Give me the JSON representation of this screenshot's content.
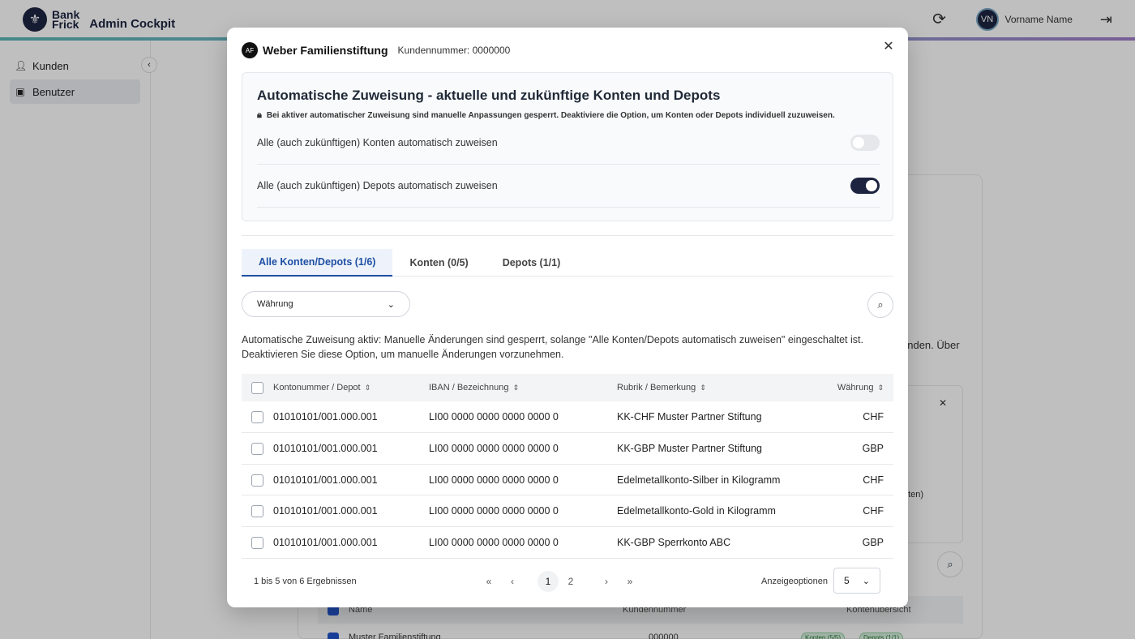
{
  "app": {
    "brand_line1": "Bank",
    "brand_line2": "Frick",
    "title": "Admin Cockpit",
    "user_initials": "VN",
    "user_name": "Vorname Name"
  },
  "sidebar": {
    "items": [
      {
        "label": "Kunden",
        "icon": "user-icon"
      },
      {
        "label": "Benutzer",
        "icon": "user-card-icon"
      }
    ]
  },
  "background": {
    "text_fragment": "unden. Über",
    "small_fragment": "nten)",
    "table_headers": [
      "Name",
      "Kundennummer",
      "Kontenübersicht"
    ],
    "row": {
      "name": "Muster Familienstiftung",
      "number": "000000",
      "badge1": "Konten (5/5)",
      "badge2": "Depots (1/1)"
    }
  },
  "modal": {
    "badge": "AF",
    "client_name": "Weber Familienstiftung",
    "client_number": "Kundennummer: 0000000",
    "auto": {
      "title": "Automatische Zuweisung - aktuelle und zukünftige Konten und Depots",
      "note": "Bei aktiver automatischer Zuweisung sind manuelle Anpassungen gesperrt. Deaktiviere die Option, um Konten oder Depots individuell zuzuweisen.",
      "toggles": [
        {
          "label": "Alle (auch zukünftigen) Konten automatisch zuweisen",
          "on": false
        },
        {
          "label": "Alle (auch zukünftigen) Depots automatisch zuweisen",
          "on": true
        }
      ]
    },
    "tabs": [
      {
        "label": "Alle Konten/Depots (1/6)",
        "active": true
      },
      {
        "label": "Konten (0/5)",
        "active": false
      },
      {
        "label": "Depots (1/1)",
        "active": false
      }
    ],
    "filter_label": "Währung",
    "info_line1": "Automatische Zuweisung aktiv: Manuelle Änderungen sind gesperrt, solange \"Alle Konten/Depots automatisch zuweisen\" eingeschaltet ist.",
    "info_line2": "Deaktivieren Sie diese Option, um manuelle Änderungen vorzunehmen.",
    "table": {
      "headers": {
        "konto": "Kontonummer / Depot",
        "iban": "IBAN / Bezeichnung",
        "rubrik": "Rubrik / Bemerkung",
        "currency": "Währung"
      },
      "rows": [
        {
          "konto": "01010101/001.000.001",
          "iban": "LI00 0000 0000 0000 0000 0",
          "rubrik": "KK-CHF Muster Partner Stiftung",
          "currency": "CHF"
        },
        {
          "konto": "01010101/001.000.001",
          "iban": "LI00 0000 0000 0000 0000 0",
          "rubrik": "KK-GBP Muster Partner Stiftung",
          "currency": "GBP"
        },
        {
          "konto": "01010101/001.000.001",
          "iban": "LI00 0000 0000 0000 0000 0",
          "rubrik": "Edelmetallkonto-Silber in Kilogramm",
          "currency": "CHF"
        },
        {
          "konto": "01010101/001.000.001",
          "iban": "LI00 0000 0000 0000 0000 0",
          "rubrik": "Edelmetallkonto-Gold in Kilogramm",
          "currency": "CHF"
        },
        {
          "konto": "01010101/001.000.001",
          "iban": "LI00 0000 0000 0000 0000 0",
          "rubrik": "KK-GBP Sperrkonto ABC",
          "currency": "GBP"
        }
      ]
    },
    "pager": {
      "result_count": "1 bis 5 von 6 Ergebnissen",
      "pages": [
        "1",
        "2"
      ],
      "current_page": "1",
      "display_label": "Anzeigeoptionen",
      "page_size": "5"
    }
  }
}
